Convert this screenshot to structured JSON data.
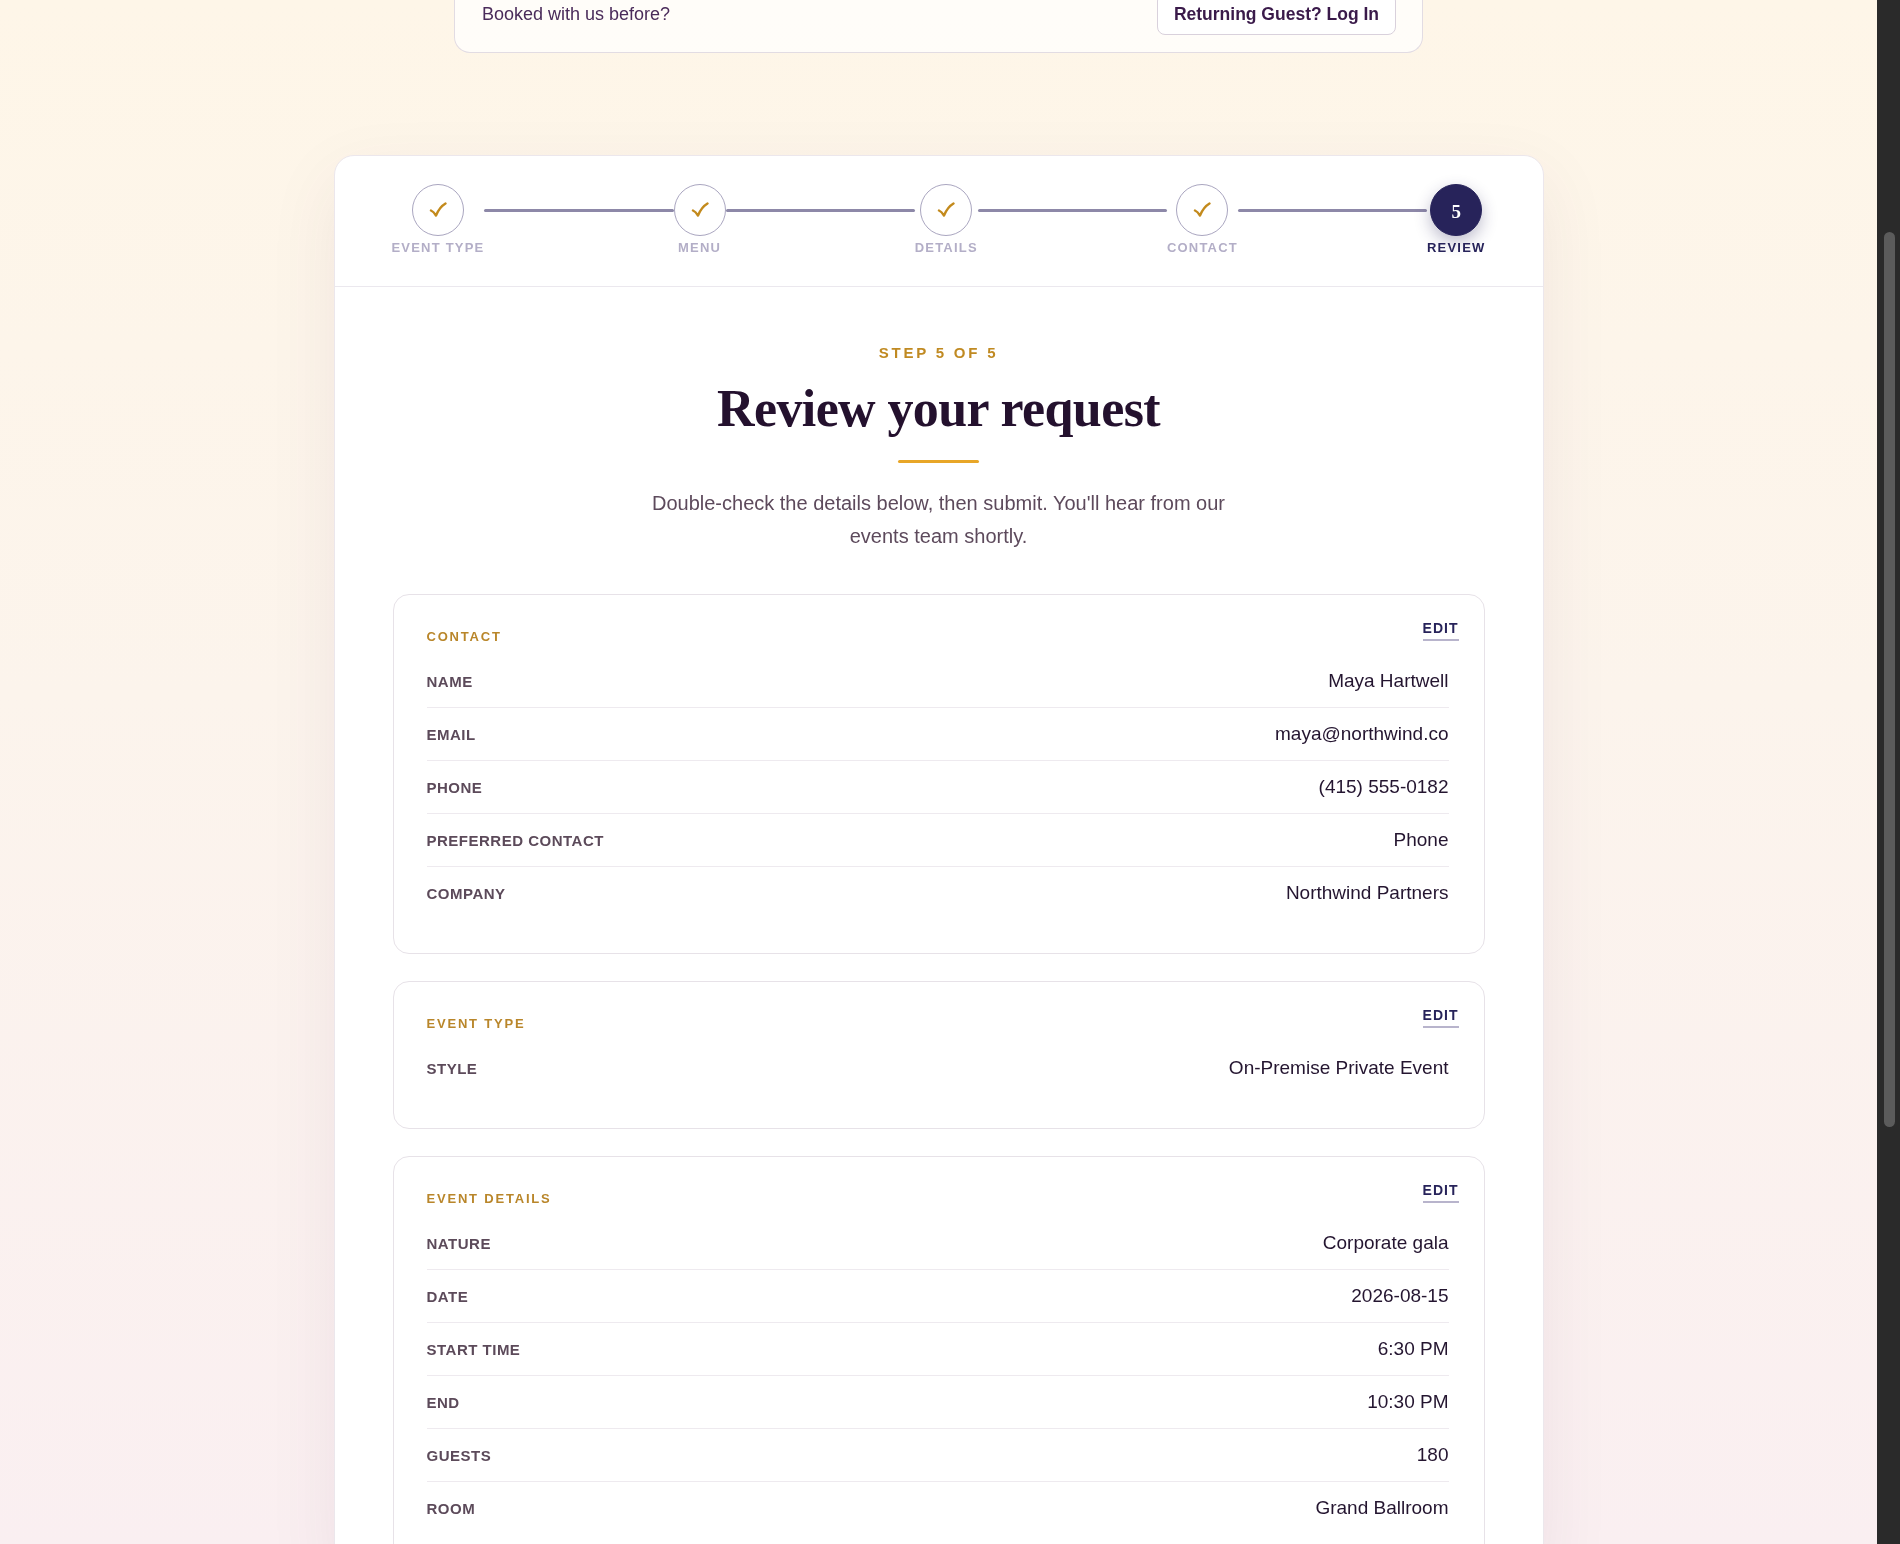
{
  "returning_banner": {
    "text": "Booked with us before?",
    "button": "Returning Guest? Log In"
  },
  "stepper": {
    "steps": [
      {
        "label": "EVENT TYPE",
        "completed": true,
        "selected": false
      },
      {
        "label": "MENU",
        "completed": true,
        "selected": false
      },
      {
        "label": "DETAILS",
        "completed": true,
        "selected": false
      },
      {
        "label": "CONTACT",
        "completed": true,
        "selected": false
      },
      {
        "label": "REVIEW",
        "number": "5",
        "completed": false,
        "selected": true
      }
    ]
  },
  "header": {
    "eyebrow": "STEP 5 OF 5",
    "title": "Review your request",
    "intro": "Double-check the details below, then submit. You'll hear from our events team shortly."
  },
  "sections": [
    {
      "title": "CONTACT",
      "edit": "EDIT",
      "rows": [
        {
          "label": "NAME",
          "value": "Maya Hartwell"
        },
        {
          "label": "EMAIL",
          "value": "maya@northwind.co"
        },
        {
          "label": "PHONE",
          "value": "(415) 555-0182"
        },
        {
          "label": "PREFERRED CONTACT",
          "value": "Phone"
        },
        {
          "label": "COMPANY",
          "value": "Northwind Partners"
        }
      ]
    },
    {
      "title": "EVENT TYPE",
      "edit": "EDIT",
      "rows": [
        {
          "label": "STYLE",
          "value": "On-Premise Private Event"
        }
      ]
    },
    {
      "title": "EVENT DETAILS",
      "edit": "EDIT",
      "rows": [
        {
          "label": "NATURE",
          "value": "Corporate gala"
        },
        {
          "label": "DATE",
          "value": "2026-08-15"
        },
        {
          "label": "START TIME",
          "value": "6:30 PM"
        },
        {
          "label": "END",
          "value": "10:30 PM"
        },
        {
          "label": "GUESTS",
          "value": "180"
        },
        {
          "label": "ROOM",
          "value": "Grand Ballroom"
        }
      ]
    }
  ]
}
